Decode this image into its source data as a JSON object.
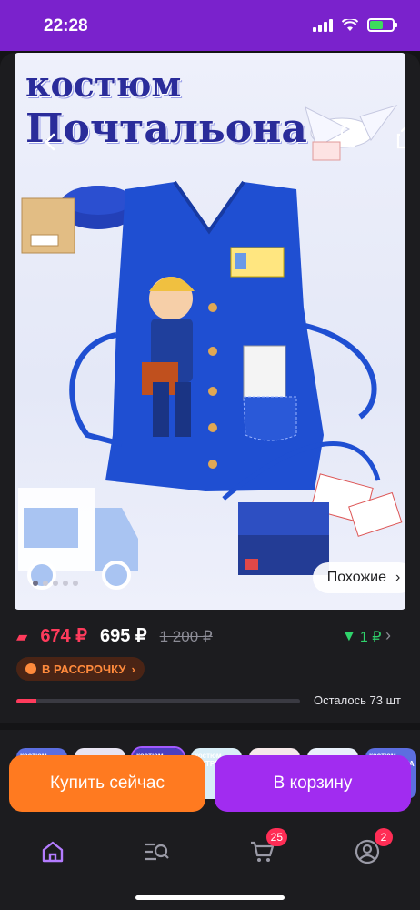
{
  "status_bar": {
    "time": "22:28"
  },
  "product_image": {
    "title_line1": "костюм",
    "title_line2": "Почтальона",
    "similar_label": "Похожие"
  },
  "prices": {
    "card_price": "674 ₽",
    "price": "695 ₽",
    "old_price": "1 200 ₽",
    "drop": "1 ₽"
  },
  "installment_label": "В РАССРОЧКУ",
  "stock": {
    "text": "Осталось 73 шт",
    "progress": 0.07
  },
  "thumbnails": [
    "костюм ДОКТОР",
    "",
    "костюм ПОЧТАЛЬОНА",
    "костюм МАТРЁШКИ",
    "",
    "",
    "костюм МЕДСЕСТРА"
  ],
  "actions": {
    "buy_now": "Купить сейчас",
    "add_to_cart": "В корзину"
  },
  "nav": {
    "cart_badge": "25",
    "profile_badge": "2"
  },
  "colors": {
    "accent_purple": "#a12cf0",
    "buy_orange": "#ff7a20",
    "price_red": "#ff3b5c",
    "drop_green": "#2fd36b"
  }
}
